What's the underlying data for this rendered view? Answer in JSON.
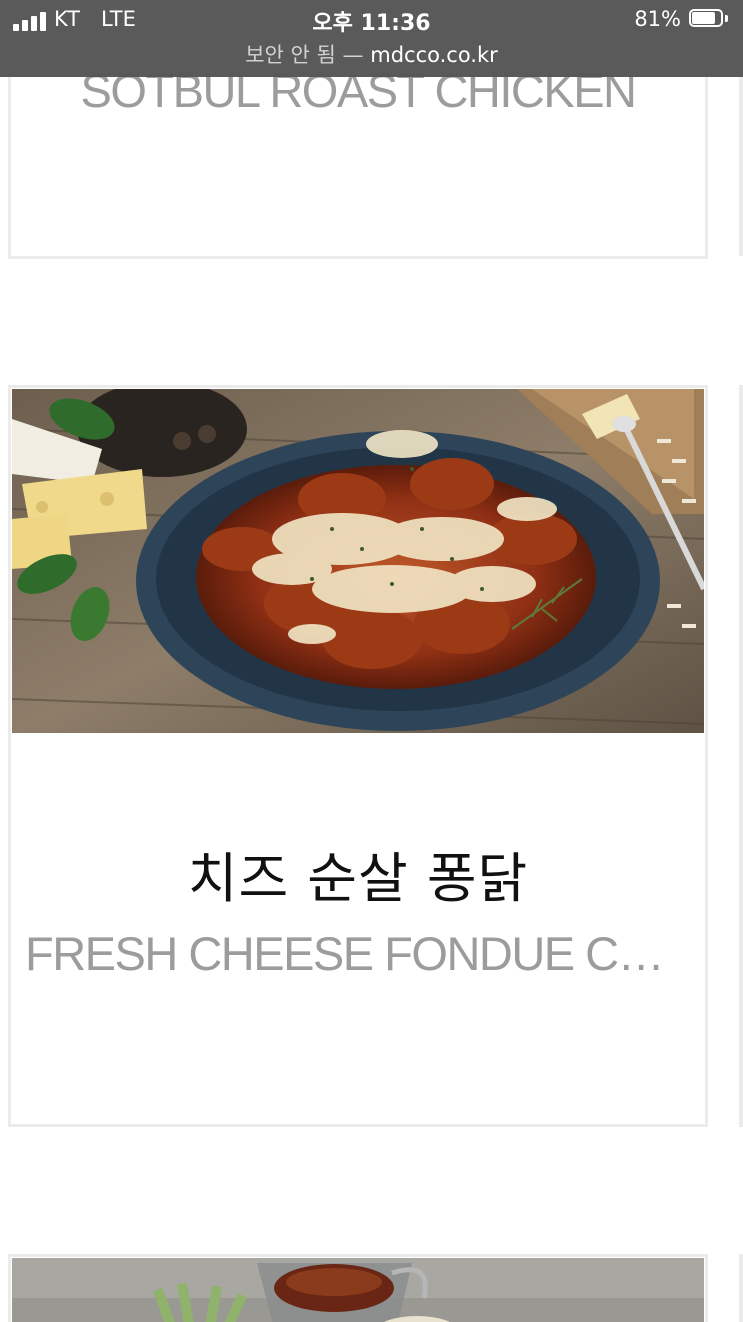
{
  "status_bar": {
    "carrier": "KT",
    "network": "LTE",
    "time": "오후 11:36",
    "battery_percent": "81%",
    "battery_level": 0.81,
    "signal_bars": 4,
    "url_security": "보안 안 됨 —",
    "url_domain": "mdcco.co.kr"
  },
  "menu": {
    "items": [
      {
        "english_name": "SOTBUL ROAST CHICKEN"
      },
      {
        "korean_name": "치즈 순살 퐁닭",
        "english_name": "FRESH CHEESE FONDUE CHICKEN"
      }
    ]
  },
  "colors": {
    "status_bar_bg": "#555555",
    "card_border": "#ebebeb",
    "english_name": "#9c9c9c",
    "korean_name": "#111111",
    "plate": "#2e4459",
    "wood": "#8a7a66"
  },
  "icons": {
    "signal": "signal-icon",
    "battery": "battery-icon"
  }
}
